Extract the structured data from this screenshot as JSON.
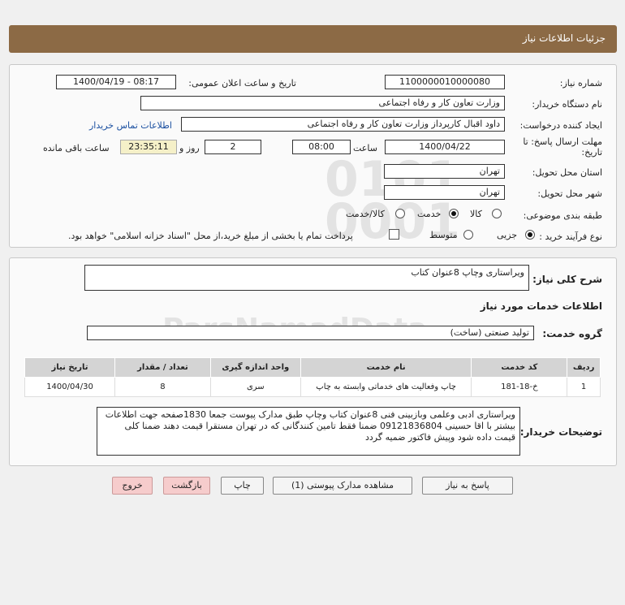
{
  "header": {
    "title": "جزئیات اطلاعات نیاز"
  },
  "form": {
    "need_number_label": "شماره نیاز:",
    "need_number": "1100000010000080",
    "announce_label": "تاریخ و ساعت اعلان عمومی:",
    "announce_value": "1400/04/19 - 08:17",
    "buyer_org_label": "نام دستگاه خریدار:",
    "buyer_org": "وزارت تعاون کار و رفاه اجتماعی",
    "creator_label": "ایجاد کننده درخواست:",
    "creator": "داود اقبال کارپرداز وزارت تعاون کار و رفاه اجتماعی",
    "contact_link": "اطلاعات تماس خریدار",
    "deadline_label_1": "مهلت ارسال پاسخ: تا",
    "deadline_label_2": "تاریخ:",
    "deadline_date": "1400/04/22",
    "time_label": "ساعت",
    "deadline_time": "08:00",
    "days_value": "2",
    "days_label": "روز و",
    "remaining_time": "23:35:11",
    "remaining_label": "ساعت باقی مانده",
    "province_label": "استان محل تحویل:",
    "province": "تهران",
    "city_label": "شهر محل تحویل:",
    "city": "تهران",
    "category_label": "طبقه بندی موضوعی:",
    "category_options": [
      "کالا",
      "خدمت",
      "کالا/خدمت"
    ],
    "process_label": "نوع فرآیند خرید :",
    "process_options": [
      "جزیی",
      "متوسط"
    ],
    "payment_note": "پرداخت تمام یا بخشی از مبلغ خرید،از محل \"اسناد خزانه اسلامی\" خواهد بود."
  },
  "details": {
    "summary_label": "شرح کلی نیاز:",
    "summary": "ویراستاری وچاپ 8عنوان کتاب",
    "services_heading": "اطلاعات خدمات مورد نیاز",
    "service_group_label": "گروه خدمت:",
    "service_group": "تولید صنعتی (ساخت)",
    "table": {
      "headers": [
        "ردیف",
        "کد خدمت",
        "نام خدمت",
        "واحد اندازه گیری",
        "تعداد / مقدار",
        "تاریخ نیاز"
      ],
      "rows": [
        [
          "1",
          "خ-18-181",
          "چاپ وفعالیت های خدماتی وابسته به چاپ",
          "سری",
          "8",
          "1400/04/30"
        ]
      ]
    },
    "buyer_notes_label": "توضیحات خریدار:",
    "buyer_notes": "ویراستاری ادبی وعلمی وبازبینی فنی 8عنوان کتاب وچاپ طبق مدارک پیوست جمعا 1830صفحه جهت اطلاعات بیشتر با اقا حسینی 09121836804 ضمنا فقط تامین کنندگانی که در تهران مستقرا قیمت دهند ضمنا کلی قیمت داده شود وپیش فاکتور ضمیه گردد"
  },
  "buttons": {
    "reply": "پاسخ به نیاز",
    "attachments": "مشاهده مدارک پیوستی (1)",
    "print": "چاپ",
    "back": "بازگشت",
    "exit": "خروج"
  },
  "colors": {
    "header": "#8c6a45",
    "exit_button": "#f6cccc",
    "remaining_time_bg": "#f5f0c8"
  }
}
